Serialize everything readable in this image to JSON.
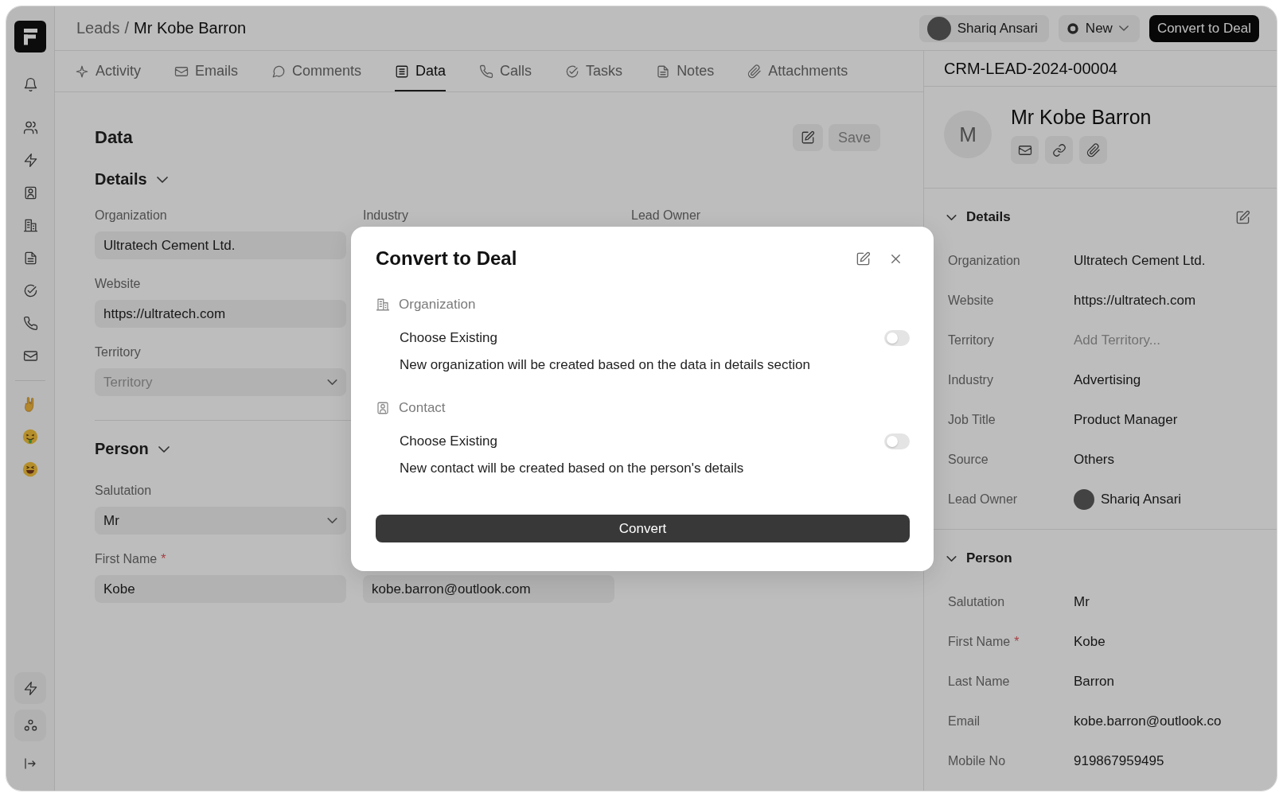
{
  "breadcrumb": {
    "parent": "Leads",
    "separator": "/",
    "current": "Mr Kobe Barron"
  },
  "header_actions": {
    "owner": "Shariq Ansari",
    "status": "New",
    "primary_button": "Convert to Deal"
  },
  "tabs": [
    {
      "label": "Activity",
      "selected": false
    },
    {
      "label": "Emails",
      "selected": false
    },
    {
      "label": "Comments",
      "selected": false
    },
    {
      "label": "Data",
      "selected": true
    },
    {
      "label": "Calls",
      "selected": false
    },
    {
      "label": "Tasks",
      "selected": false
    },
    {
      "label": "Notes",
      "selected": false
    },
    {
      "label": "Attachments",
      "selected": false
    }
  ],
  "data_panel": {
    "title": "Data",
    "save_button": "Save",
    "sections": [
      {
        "title": "Details",
        "expanded": true,
        "rows": [
          [
            {
              "label": "Organization",
              "kind": "input",
              "value": "Ultratech Cement Ltd."
            },
            {
              "label": "Industry"
            },
            {
              "label": "Lead Owner"
            }
          ],
          [
            {
              "label": "Website",
              "kind": "input",
              "value": "https://ultratech.com"
            }
          ],
          [
            {
              "label": "Territory",
              "kind": "select",
              "placeholder": "Territory"
            }
          ]
        ]
      },
      {
        "title": "Person",
        "expanded": true,
        "rows": [
          [
            {
              "label": "Salutation",
              "kind": "select",
              "value": "Mr"
            }
          ],
          [
            {
              "label": "First Name",
              "required_mark": "*",
              "kind": "input",
              "value": "Kobe"
            },
            {
              "kind": "input",
              "value": "kobe.barron@outlook.com"
            }
          ]
        ]
      }
    ]
  },
  "side_panel": {
    "record_id": "CRM-LEAD-2024-00004",
    "avatar_initial": "M",
    "name": "Mr Kobe Barron",
    "sections": [
      {
        "title": "Details",
        "expanded": true,
        "fields": [
          {
            "label": "Organization",
            "kind": "text",
            "value": "Ultratech Cement Ltd."
          },
          {
            "label": "Website",
            "kind": "text",
            "value": "https://ultratech.com"
          },
          {
            "label": "Territory",
            "kind": "text",
            "placeholder": "Add Territory..."
          },
          {
            "label": "Industry",
            "kind": "text",
            "value": "Advertising"
          },
          {
            "label": "Job Title",
            "kind": "text",
            "value": "Product Manager"
          },
          {
            "label": "Source",
            "kind": "text",
            "value": "Others"
          },
          {
            "label": "Lead Owner",
            "kind": "user",
            "value": "Shariq Ansari"
          }
        ]
      },
      {
        "title": "Person",
        "expanded": true,
        "fields": [
          {
            "label": "Salutation",
            "kind": "text",
            "value": "Mr"
          },
          {
            "label": "First Name",
            "required_mark": "*",
            "kind": "text",
            "value": "Kobe"
          },
          {
            "label": "Last Name",
            "kind": "text",
            "value": "Barron"
          },
          {
            "label": "Email",
            "kind": "text",
            "value": "kobe.barron@outlook.co"
          },
          {
            "label": "Mobile No",
            "kind": "text",
            "value": "919867959495"
          }
        ]
      }
    ]
  },
  "modal": {
    "title": "Convert to Deal",
    "groups": [
      {
        "title": "Organization",
        "option": "Choose Existing",
        "on": false,
        "note": "New organization will be created based on the data in details section"
      },
      {
        "title": "Contact",
        "option": "Choose Existing",
        "on": false,
        "note": "New contact will be created based on the person's details"
      }
    ],
    "button": "Convert"
  }
}
